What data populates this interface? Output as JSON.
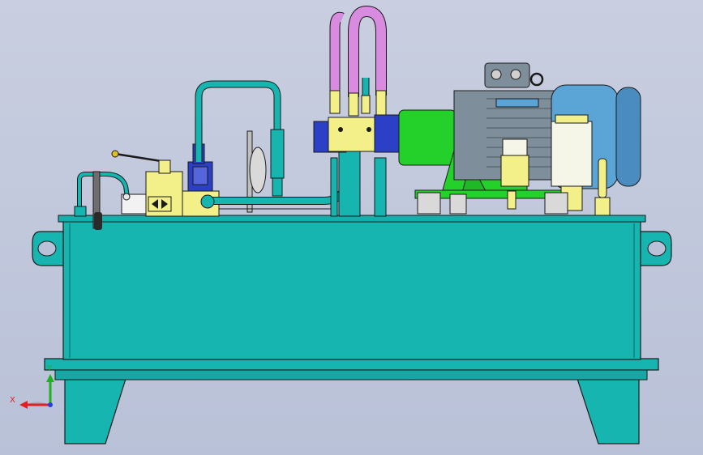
{
  "viewport": {
    "background_top": "#c9cfe0",
    "background_bottom": "#b9c1d8"
  },
  "colors": {
    "tank": "#17b5b0",
    "tank_dark": "#0e8f8c",
    "outline": "#1a1a1a",
    "motor_blue": "#5aa4d6",
    "motor_gray": "#7e8e9a",
    "coupling_green": "#23d12a",
    "hose_pink": "#d98be0",
    "valve_yellow": "#f3f08a",
    "valve_blue": "#2c3fc7",
    "filter_cream": "#f5f5e8"
  },
  "triad": {
    "x_label": "X",
    "y_label": "Y",
    "x_color": "#e02020",
    "y_color": "#20b020",
    "z_color": "#2040e0"
  }
}
